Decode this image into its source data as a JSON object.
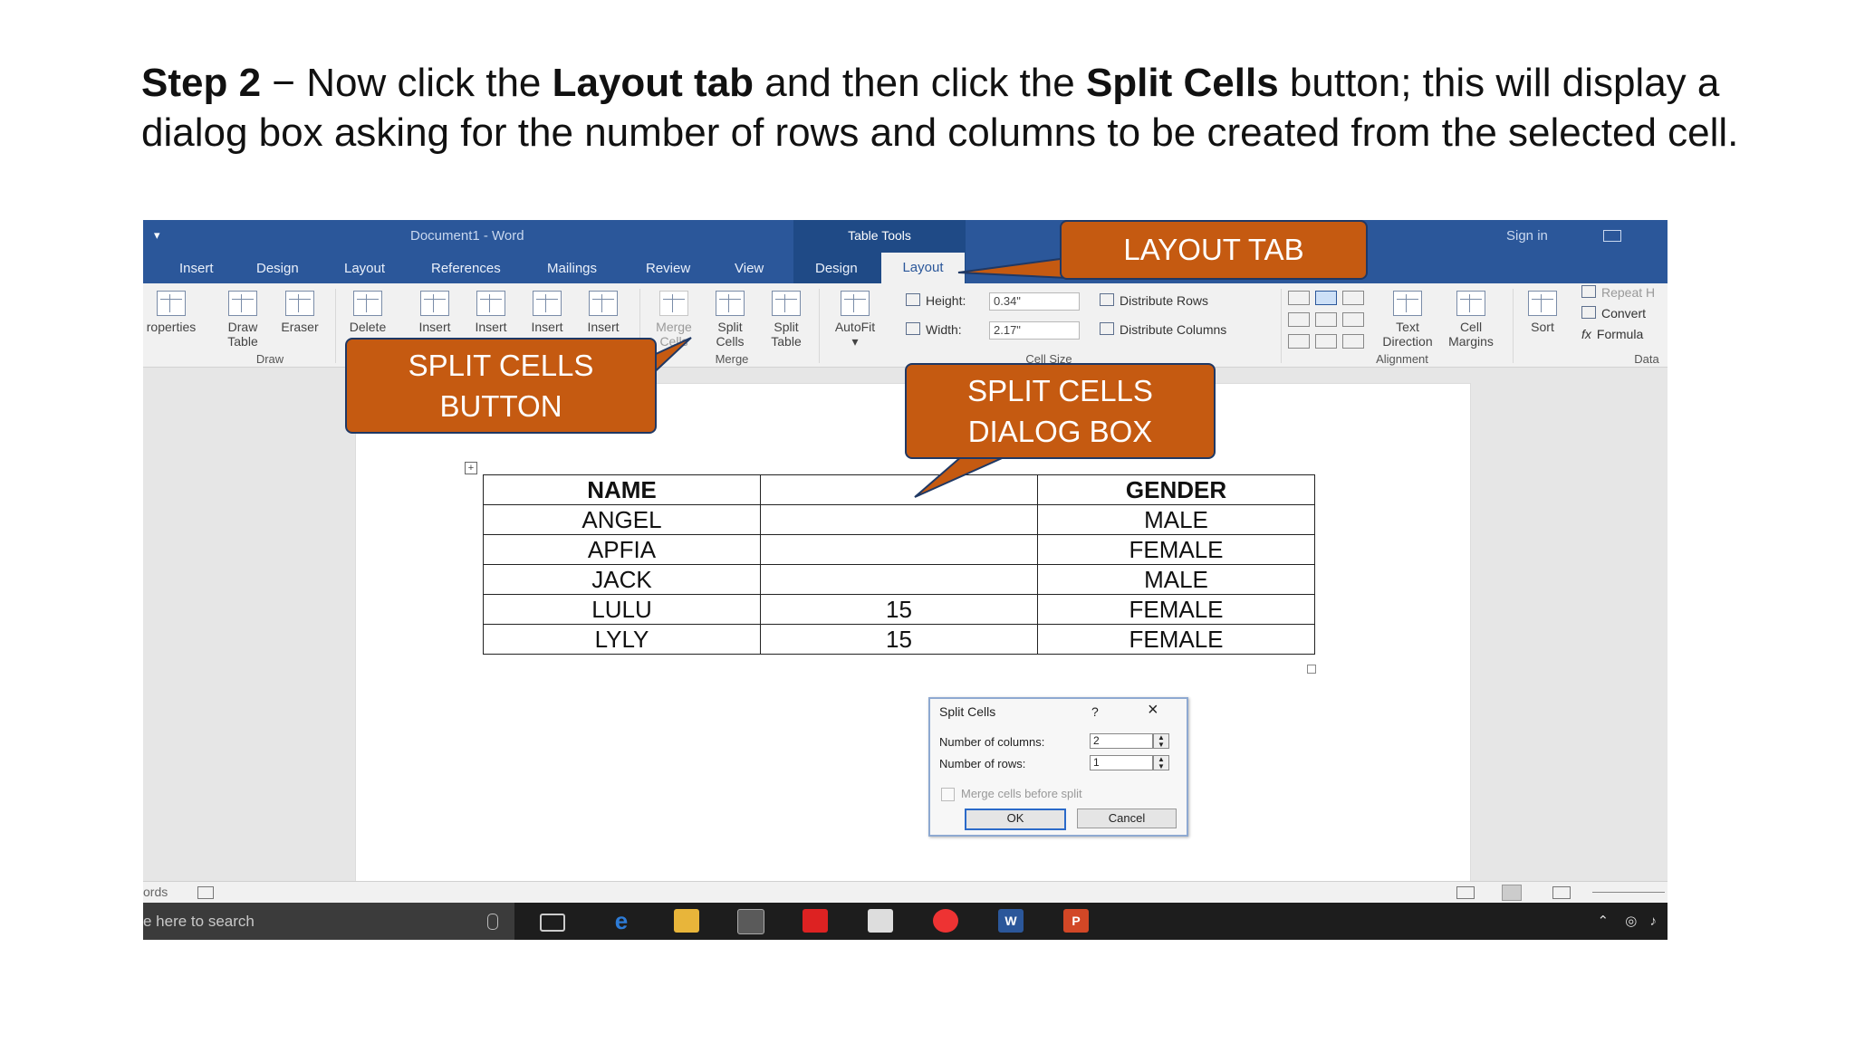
{
  "instruction": {
    "step_label": "Step 2",
    "part1": " − Now click the ",
    "layout_tab": "Layout tab",
    "part2": " and then click the ",
    "split_cells": "Split Cells",
    "part3": " button; this will display a dialog box asking for the number of rows and columns to be created from the selected cell."
  },
  "word": {
    "doc_title": "Document1  -  Word",
    "table_tools": "Table Tools",
    "sign_in": "Sign in",
    "tabs": [
      "Insert",
      "Design",
      "Layout",
      "References",
      "Mailings",
      "Review",
      "View",
      "Design"
    ],
    "active_tab": "Layout",
    "ribbon": {
      "properties": "roperties",
      "draw_table_1": "Draw",
      "draw_table_2": "Table",
      "eraser": "Eraser",
      "group_draw": "Draw",
      "delete": "Delete",
      "insert": "Insert",
      "merge_1": "Merge",
      "merge_2": "Cells",
      "split_cells_1": "Split",
      "split_cells_2": "Cells",
      "split_table_1": "Split",
      "split_table_2": "Table",
      "group_merge": "Merge",
      "autofit": "AutoFit",
      "height_label": "Height:",
      "height_value": "0.34\"",
      "width_label": "Width:",
      "width_value": "2.17\"",
      "distribute_rows": "Distribute Rows",
      "distribute_columns": "Distribute Columns",
      "group_cell_size": "Cell Size",
      "text_direction_1": "Text",
      "text_direction_2": "Direction",
      "cell_margins_1": "Cell",
      "cell_margins_2": "Margins",
      "group_alignment": "Alignment",
      "sort": "Sort",
      "repeat": "Repeat H",
      "convert": "Convert",
      "formula": "Formula",
      "group_data": "Data"
    },
    "table": {
      "headers": [
        "NAME",
        "",
        "GENDER"
      ],
      "rows": [
        [
          "ANGEL",
          "",
          "MALE"
        ],
        [
          "APFIA",
          "",
          "FEMALE"
        ],
        [
          "JACK",
          "",
          "MALE"
        ],
        [
          "LULU",
          "15",
          "FEMALE"
        ],
        [
          "LYLY",
          "15",
          "FEMALE"
        ]
      ]
    },
    "dialog": {
      "title": "Split Cells",
      "help": "?",
      "columns_label": "Number of columns:",
      "columns_value": "2",
      "rows_label": "Number of rows:",
      "rows_value": "1",
      "merge_label": "Merge cells before split",
      "ok": "OK",
      "cancel": "Cancel"
    },
    "status_words": "ords",
    "taskbar_search": "e here to search"
  },
  "callouts": {
    "layout_tab": "LAYOUT TAB",
    "split_button_1": "SPLIT CELLS",
    "split_button_2": "BUTTON",
    "dialog_1": "SPLIT CELLS",
    "dialog_2": "DIALOG BOX"
  },
  "colors": {
    "word_blue": "#2b579a",
    "callout_orange": "#c55a11",
    "callout_border": "#1f3864"
  }
}
